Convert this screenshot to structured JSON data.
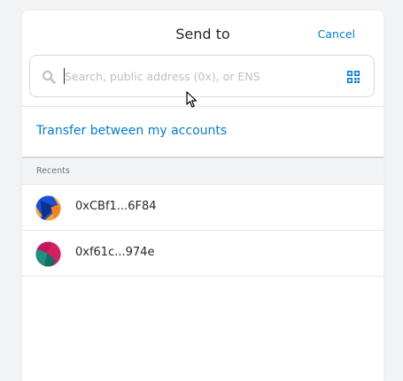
{
  "header": {
    "title": "Send to",
    "cancel_label": "Cancel"
  },
  "search": {
    "placeholder": "Search, public address (0x), or ENS",
    "value": "",
    "icon": "search-icon",
    "scan_icon": "qr-code-icon"
  },
  "transfer_link": "Transfer between my accounts",
  "recents": {
    "label": "Recents",
    "items": [
      {
        "address": "0xCBf1...6F84",
        "avatar": "identicon"
      },
      {
        "address": "0xf61c...974e",
        "avatar": "identicon"
      }
    ]
  },
  "colors": {
    "accent": "#037dd6",
    "text": "#24272a",
    "muted": "#6a737d",
    "border": "#d6d9dc",
    "background": "#f2f3f4"
  }
}
